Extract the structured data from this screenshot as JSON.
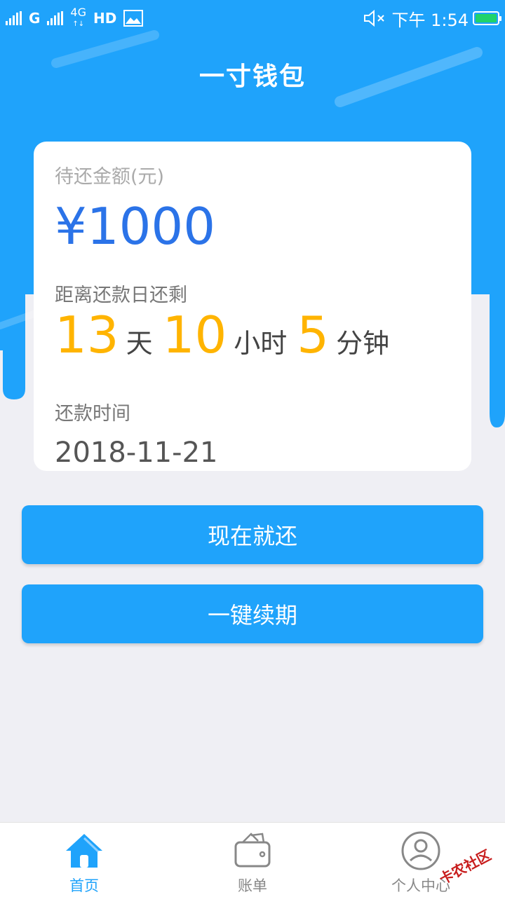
{
  "status_bar": {
    "network_g": "G",
    "network_4g": "4G",
    "hd": "HD",
    "time": "下午 1:54"
  },
  "header": {
    "title": "一寸钱包"
  },
  "card": {
    "amount_label": "待还金额(元)",
    "amount": "¥1000",
    "countdown_label": "距离还款日还剩",
    "countdown": {
      "days": "13",
      "days_unit": "天",
      "hours": "10",
      "hours_unit": "小时",
      "minutes": "5",
      "minutes_unit": "分钟"
    },
    "due_label": "还款时间",
    "due_date": "2018-11-21"
  },
  "actions": {
    "repay_label": "现在就还",
    "renew_label": "一键续期"
  },
  "tabs": [
    {
      "label": "首页",
      "icon": "home-icon",
      "active": true
    },
    {
      "label": "账单",
      "icon": "wallet-icon",
      "active": false
    },
    {
      "label": "个人中心",
      "icon": "user-icon",
      "active": false
    }
  ],
  "watermark": {
    "text": "卡农社区"
  },
  "colors": {
    "brand_blue": "#1fa3fb",
    "amount_blue": "#2b73e8",
    "countdown_yellow": "#ffb400"
  }
}
